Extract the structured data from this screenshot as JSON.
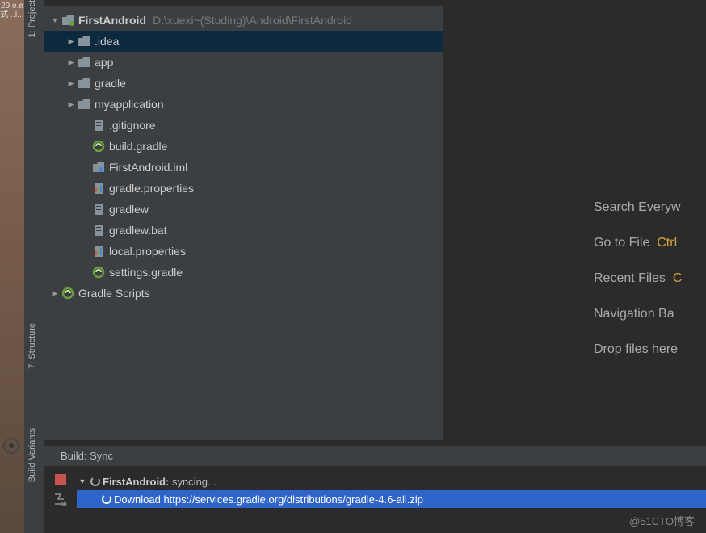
{
  "leftGutter": {
    "top_text": "29\ne.e\n式\n..I..."
  },
  "sidebarLabels": {
    "project": "1: Project",
    "structure": "7: Structure",
    "buildVariants": "Build Variants"
  },
  "projectTree": {
    "root": {
      "name": "FirstAndroid",
      "path": "D:\\xuexi~(Studing)\\Android\\FirstAndroid"
    },
    "items": [
      {
        "name": ".idea",
        "type": "folder",
        "expandable": true,
        "selected": true
      },
      {
        "name": "app",
        "type": "folder",
        "expandable": true
      },
      {
        "name": "gradle",
        "type": "folder",
        "expandable": true
      },
      {
        "name": "myapplication",
        "type": "folder",
        "expandable": true
      },
      {
        "name": ".gitignore",
        "type": "text"
      },
      {
        "name": "build.gradle",
        "type": "gradle"
      },
      {
        "name": "FirstAndroid.iml",
        "type": "iml"
      },
      {
        "name": "gradle.properties",
        "type": "props"
      },
      {
        "name": "gradlew",
        "type": "text"
      },
      {
        "name": "gradlew.bat",
        "type": "text"
      },
      {
        "name": "local.properties",
        "type": "props"
      },
      {
        "name": "settings.gradle",
        "type": "gradle"
      }
    ],
    "scripts": "Gradle Scripts"
  },
  "tips": {
    "search": "Search Everyw",
    "gotoFile": "Go to File",
    "gotoFileKey": "Ctrl",
    "recent": "Recent Files",
    "recentKey": "C",
    "navBar": "Navigation Ba",
    "drop": "Drop files here"
  },
  "build": {
    "header": "Build: Sync",
    "project": "FirstAndroid:",
    "status": "syncing...",
    "download_prefix": "Download",
    "download_url": "https://services.gradle.org/distributions/gradle-4.6-all.zip"
  },
  "watermark": "@51CTO博客"
}
